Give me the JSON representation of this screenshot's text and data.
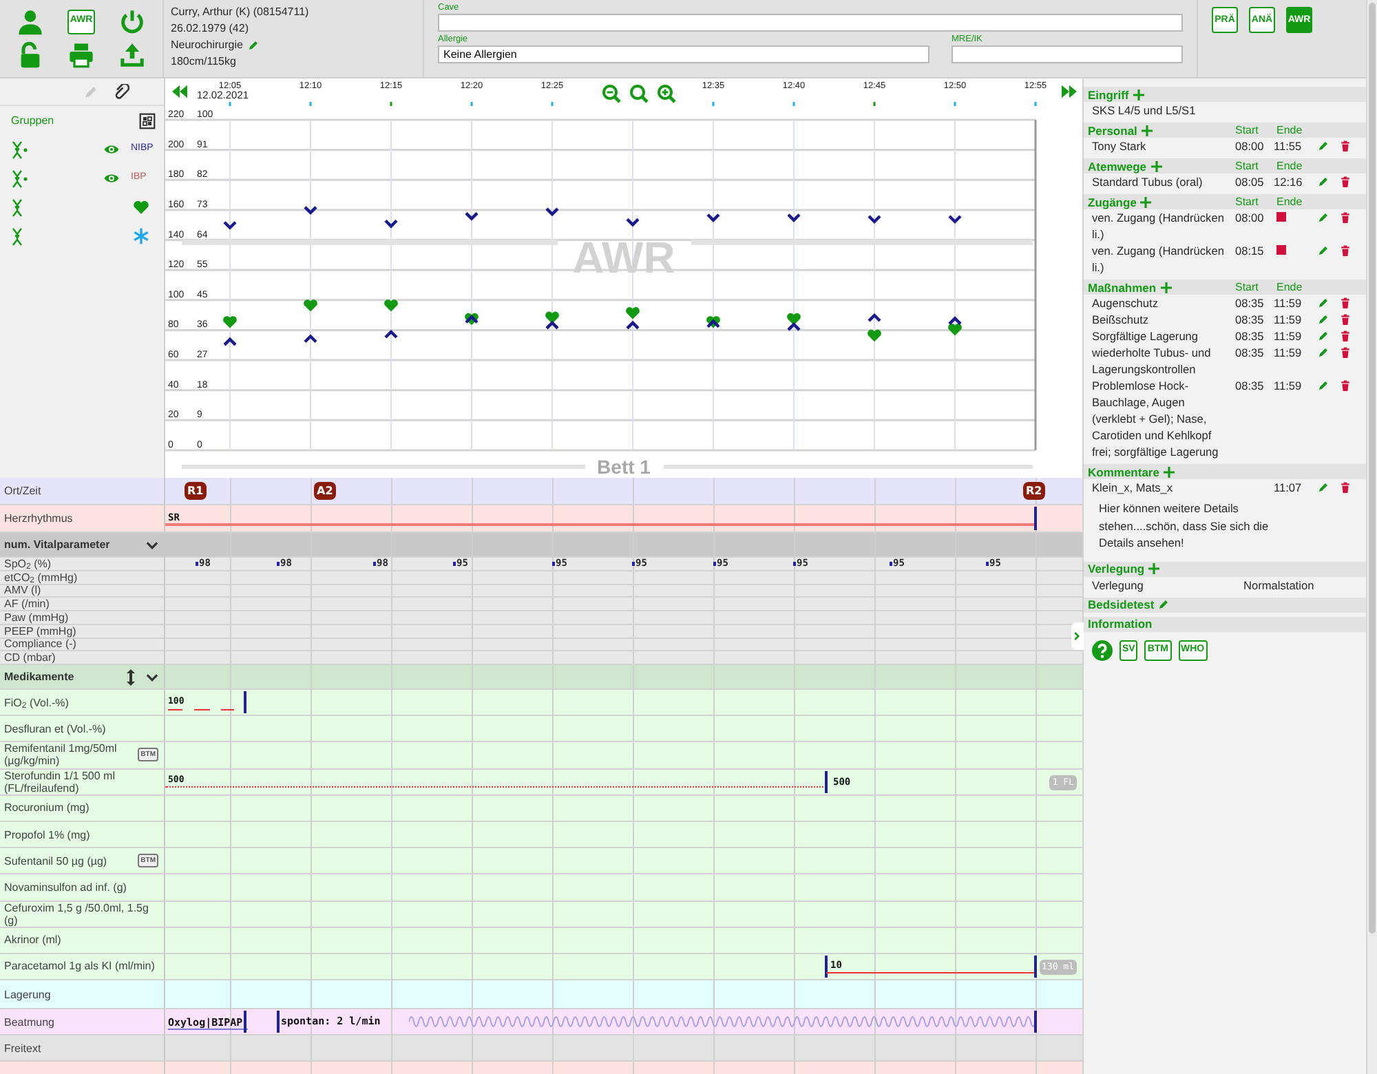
{
  "header": {
    "app_badge": "AWR",
    "patient": {
      "name": "Curry, Arthur (K) (08154711)",
      "birth": "26.02.1979 (42)",
      "department": "Neurochirurgie",
      "size": "180cm/115kg"
    },
    "fields": [
      {
        "label": "Cave"
      },
      {
        "label": "Allergie",
        "value": "Keine Allergien"
      },
      {
        "label": "MRE/IK"
      }
    ],
    "phases": [
      {
        "label": "PRÄ",
        "selected": false
      },
      {
        "label": "ANÄ",
        "selected": false
      },
      {
        "label": "AWR",
        "selected": true
      }
    ]
  },
  "legend": {
    "title": "Gruppen",
    "rows": [
      {
        "kind": "measure",
        "visible": true,
        "label": "NIBP",
        "color": "#2a2ab4"
      },
      {
        "kind": "measure",
        "visible": true,
        "label": "IBP",
        "color": "#c25a5a"
      },
      {
        "kind": "heart",
        "color": "#139a13"
      },
      {
        "kind": "asterisk",
        "color": "#1aa6f0"
      }
    ]
  },
  "chart": {
    "date": "12.02.2021",
    "location": "AWR",
    "bed": "Bett 1",
    "percent_ticks": [
      "100",
      "91",
      "82",
      "73",
      "64",
      "55",
      "45",
      "36",
      "27",
      "18",
      "9",
      "0"
    ],
    "chart_data": {
      "type": "scatter",
      "categories": [
        "12:05",
        "12:10",
        "12:15",
        "12:20",
        "12:25",
        null,
        "12:35",
        "12:40",
        "12:45",
        "12:50",
        "12:55"
      ],
      "ylim": [
        0,
        247.5
      ],
      "grid": true,
      "yticks": [
        {
          "value": 220,
          "label": "220"
        },
        {
          "value": 200,
          "label": "200"
        },
        {
          "value": 180,
          "label": "180"
        },
        {
          "value": 160,
          "label": "160"
        },
        {
          "value": 140,
          "label": "140"
        },
        {
          "value": 120,
          "label": "120"
        },
        {
          "value": 100,
          "label": "100"
        },
        {
          "value": 80,
          "label": "80"
        },
        {
          "value": 60,
          "label": "60"
        },
        {
          "value": 40,
          "label": "40"
        },
        {
          "value": 20,
          "label": "20"
        },
        {
          "value": 0,
          "label": "0"
        }
      ],
      "series": [
        {
          "color": "#1a1a8c",
          "values": [
            150,
            160,
            151,
            156,
            159,
            152,
            155,
            155,
            154,
            154,
            null
          ]
        },
        {
          "color": "#1a1a8c",
          "values": [
            72,
            74,
            77,
            87,
            83,
            83,
            84,
            82,
            88,
            86,
            null
          ]
        },
        {
          "color": "#139a13",
          "values": [
            85,
            96,
            96,
            87,
            88,
            91,
            85,
            87,
            76,
            80,
            null
          ]
        }
      ]
    }
  },
  "lanes": [
    {
      "kind": "location",
      "label": "Ort/Zeit",
      "markers": [
        "R1",
        "A2",
        "R2"
      ]
    },
    {
      "kind": "rhythm",
      "label": "Herzrhythmus",
      "text": "SR"
    },
    {
      "kind": "group",
      "label": "num. Vitalparameter",
      "expanded": true,
      "resizable": false
    },
    {
      "kind": "vital",
      "label": "SpO$_{2}$ (%)",
      "values": [
        "98",
        "98",
        "98",
        "95",
        "95",
        "95",
        "95",
        "95",
        "95",
        "95"
      ]
    },
    {
      "kind": "vital",
      "label": "etCO$_{2}$ (mmHg)"
    },
    {
      "kind": "vital",
      "label": "AMV (l)"
    },
    {
      "kind": "vital",
      "label": "AF (/min)"
    },
    {
      "kind": "vital",
      "label": "Paw (mmHg)"
    },
    {
      "kind": "vital",
      "label": "PEEP (mmHg)"
    },
    {
      "kind": "vital",
      "label": "Compliance (-)"
    },
    {
      "kind": "vital",
      "label": "CD (mbar)"
    },
    {
      "kind": "group",
      "label": "Medikamente",
      "expanded": true,
      "resizable": true
    },
    {
      "kind": "drug",
      "label": "FiO$_{2}$ (Vol.-%)",
      "entries": [
        {
          "text": "100",
          "kind": "dashed"
        }
      ]
    },
    {
      "kind": "drug",
      "label": "Desfluran et (Vol.-%)"
    },
    {
      "kind": "drug",
      "label": "Remifentanil 1mg/50ml (µg/kg/min)",
      "badge": "BTM"
    },
    {
      "kind": "drug",
      "label": "Sterofundin 1/1 500 ml (FL/freilaufend)",
      "entries": [
        {
          "text": "500",
          "kind": "dotted"
        },
        {
          "text": "500"
        }
      ],
      "total": "1 FL"
    },
    {
      "kind": "drug",
      "label": "Rocuronium (mg)"
    },
    {
      "kind": "drug",
      "label": "Propofol 1% (mg)"
    },
    {
      "kind": "drug",
      "label": "Sufentanil 50 µg (µg)",
      "badge": "BTM"
    },
    {
      "kind": "drug",
      "label": "Novaminsulfon ad inf. (g)"
    },
    {
      "kind": "drug",
      "label": "Cefuroxim 1,5 g /50.0ml, 1.5g (g)"
    },
    {
      "kind": "drug",
      "label": "Akrinor (ml)"
    },
    {
      "kind": "drug",
      "label": "Paracetamol 1g als KI (ml/min)",
      "entries": [
        {
          "text": "10",
          "kind": "solid"
        }
      ],
      "total": "130 ml"
    },
    {
      "kind": "positioning",
      "label": "Lagerung"
    },
    {
      "kind": "ventilation",
      "label": "Beatmung",
      "entries": [
        {
          "text": "Oxylog|BIPAP"
        },
        {
          "text": "spontan: 2 l/min"
        }
      ]
    },
    {
      "kind": "freetext",
      "label": "Freitext"
    },
    {
      "kind": "events"
    }
  ],
  "sidebar": [
    {
      "title": "Eingriff",
      "add": true,
      "actions": false,
      "items": [
        {
          "name": "SKS L4/5 und L5/S1"
        }
      ]
    },
    {
      "title": "Personal",
      "add": true,
      "actions": true,
      "columns": [
        "Start",
        "Ende"
      ],
      "items": [
        {
          "name": "Tony Stark",
          "start": "08:00",
          "end": "11:55"
        }
      ]
    },
    {
      "title": "Atemwege",
      "add": true,
      "actions": true,
      "columns": [
        "Start",
        "Ende"
      ],
      "items": [
        {
          "name": "Standard Tubus (oral)",
          "start": "08:05",
          "end": "12:16"
        }
      ]
    },
    {
      "title": "Zugänge",
      "add": true,
      "actions": true,
      "columns": [
        "Start",
        "Ende"
      ],
      "items": [
        {
          "name": "ven. Zugang (Handrücken li.)",
          "start": "08:00",
          "running": true
        },
        {
          "name": "ven. Zugang (Handrücken li.)",
          "start": "08:15",
          "running": true
        }
      ]
    },
    {
      "title": "Maßnahmen",
      "add": true,
      "actions": true,
      "columns": [
        "Start",
        "Ende"
      ],
      "items": [
        {
          "name": "Augenschutz",
          "start": "08:35",
          "end": "11:59"
        },
        {
          "name": "Beißschutz",
          "start": "08:35",
          "end": "11:59"
        },
        {
          "name": "Sorgfältige Lagerung",
          "start": "08:35",
          "end": "11:59"
        },
        {
          "name": "wiederholte Tubus- und Lagerungskontrollen",
          "start": "08:35",
          "end": "11:59"
        },
        {
          "name": "Problemlose Hock-Bauchlage, Augen (verklebt + Gel); Nase, Carotiden und Kehlkopf frei; sorgfältige Lagerung",
          "start": "08:35",
          "end": "11:59"
        }
      ]
    },
    {
      "title": "Kommentare",
      "add": true,
      "actions": true,
      "items": [
        {
          "name": "Klein_x, Mats_x",
          "end": "11:07",
          "note": "Hier können weitere Details stehen....schön, dass Sie sich die Details ansehen!"
        }
      ]
    },
    {
      "title": "Verlegung",
      "add": true,
      "actions": false,
      "items": [
        {
          "name": "Verlegung",
          "value": "Normalstation"
        }
      ]
    },
    {
      "title": "Bedsidetest",
      "add": false,
      "editable": true
    },
    {
      "title": "Information",
      "add": false,
      "links": [
        "SV",
        "BTM",
        "WHO"
      ]
    }
  ]
}
